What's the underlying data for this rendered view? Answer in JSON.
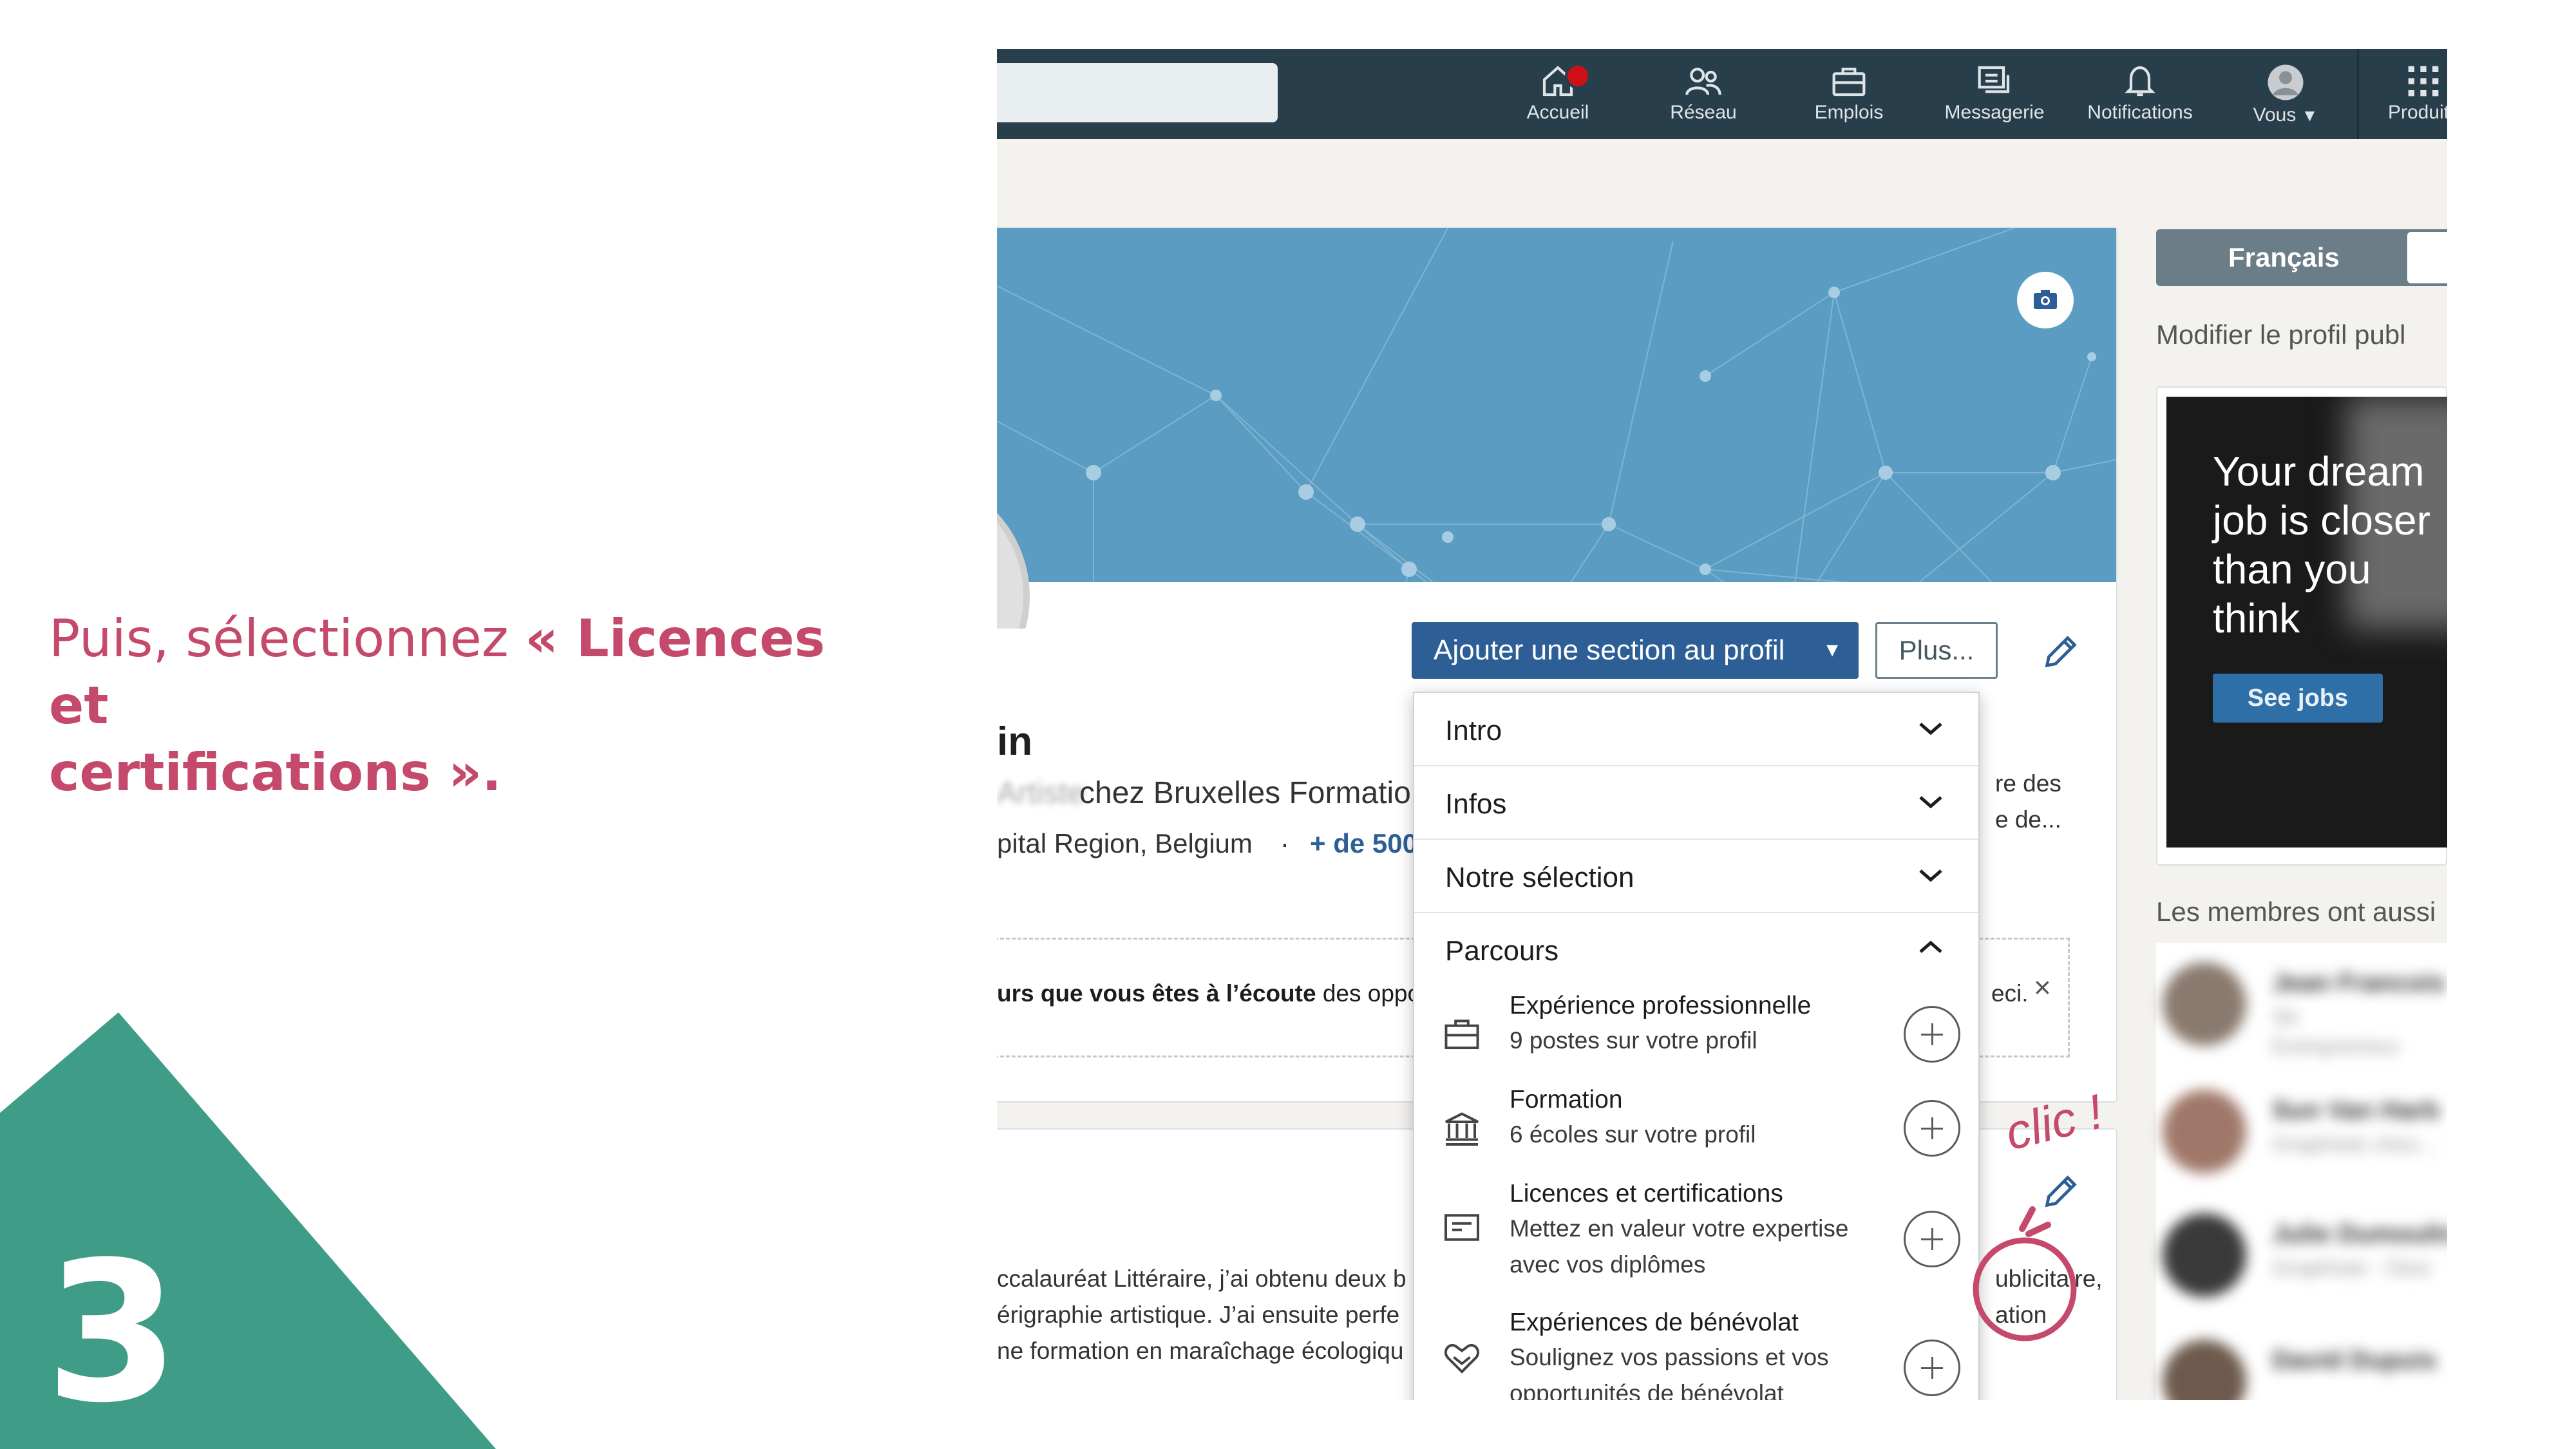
{
  "step": {
    "number": "3"
  },
  "instruction": {
    "prefix": "Puis, sélectionnez ",
    "open_quote": "« ",
    "highlight_line1": "Licences et",
    "highlight_line2": "certifications",
    "close_quote": " »."
  },
  "colors": {
    "accent": "#c4496a",
    "triangle": "#3f9c86",
    "linkedin_nav": "#283e4a",
    "primary_button": "#2d5f96"
  },
  "nav": {
    "items": [
      {
        "label": "Accueil",
        "icon": "home-icon"
      },
      {
        "label": "Réseau",
        "icon": "network-icon"
      },
      {
        "label": "Emplois",
        "icon": "briefcase-icon"
      },
      {
        "label": "Messagerie",
        "icon": "messaging-icon"
      },
      {
        "label": "Notifications",
        "icon": "bell-icon"
      },
      {
        "label": "Vous",
        "icon": "avatar"
      },
      {
        "label": "Produits",
        "icon": "grid-icon"
      }
    ]
  },
  "profile": {
    "add_section_label": "Ajouter une section au profil",
    "more_label": "Plus...",
    "name_fragment": "in",
    "headline_blurred": "Artiste",
    "headline": "chez Bruxelles Formatio",
    "location": "pital Region, Belgium",
    "location_sep": "·",
    "connections": "+ de 500",
    "right_frag1": "re des",
    "right_frag2": "e de...",
    "notice_bold": "urs que vous êtes à l’écoute",
    "notice_rest": " des oppo",
    "notice_end": "eci.",
    "about_lines": [
      "ccalauréat Littéraire, j’ai obtenu deux b",
      "érigraphie artistique. J’ai ensuite perfe",
      "ne formation en maraîchage écologiqu"
    ],
    "about_right": [
      "ublicitaire,",
      "ation"
    ]
  },
  "menu": {
    "sections": [
      "Intro",
      "Infos",
      "Notre sélection",
      "Parcours"
    ],
    "items": [
      {
        "title": "Expérience professionnelle",
        "subtitle": [
          "9 postes sur votre profil"
        ],
        "icon": "briefcase-icon"
      },
      {
        "title": "Formation",
        "subtitle": [
          "6 écoles sur votre profil"
        ],
        "icon": "school-icon"
      },
      {
        "title": "Licences et certifications",
        "subtitle": [
          "Mettez en valeur votre expertise",
          "avec vos diplômes"
        ],
        "icon": "certificate-icon"
      },
      {
        "title": "Expériences de bénévolat",
        "subtitle": [
          "Soulignez vos passions et vos",
          "opportunités de bénévolat"
        ],
        "icon": "heart-hands-icon"
      }
    ]
  },
  "annotation": {
    "label": "clic !"
  },
  "sidebar": {
    "language": "Français",
    "edit_public_profile": "Modifier le profil publ",
    "ad_lines": [
      "Your dream",
      "job is closer",
      "than you",
      "think"
    ],
    "ad_button": "See jobs",
    "members_heading": "Les membres ont aussi",
    "members": [
      {
        "name": "Jean Francois",
        "sub1": "Se",
        "sub2": "Entrepreneur"
      },
      {
        "name": "Sun Van Harb",
        "sub1": "Graphiste chez..."
      },
      {
        "name": "Julie Dumoulin",
        "sub1": "Graphiste - Desi"
      },
      {
        "name": "David Dupuis"
      }
    ]
  }
}
